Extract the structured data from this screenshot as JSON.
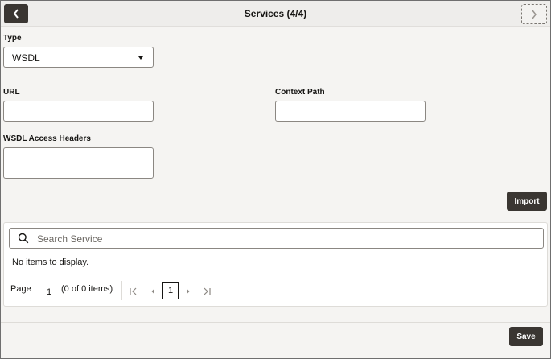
{
  "header": {
    "title": "Services (4/4)",
    "back_icon": "chevron-left-icon",
    "next_icon": "chevron-right-icon"
  },
  "form": {
    "type_label": "Type",
    "type_value": "WSDL",
    "url_label": "URL",
    "url_value": "",
    "context_path_label": "Context Path",
    "context_path_value": "",
    "wsdl_headers_label": "WSDL Access Headers",
    "wsdl_headers_value": ""
  },
  "actions": {
    "import_label": "Import",
    "save_label": "Save"
  },
  "table": {
    "search_placeholder": "Search Service",
    "empty_message": "No items to display.",
    "pager": {
      "page_label": "Page",
      "page_number": "1",
      "items_summary": "(0 of 0 items)",
      "current_page": "1"
    }
  },
  "colors": {
    "dark_button": "#3a3632",
    "background": "#f5f4f2",
    "header": "#eeedeb"
  }
}
